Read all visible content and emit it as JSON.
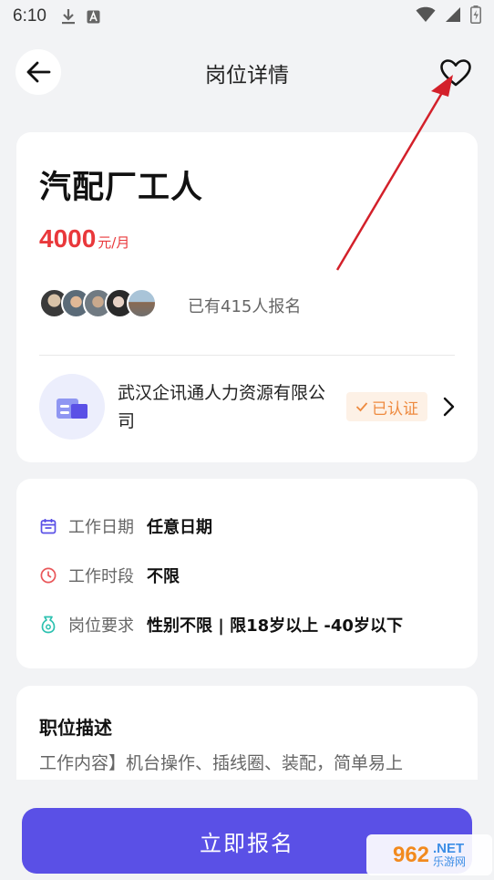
{
  "status_bar": {
    "time": "6:10"
  },
  "header": {
    "title": "岗位详情"
  },
  "job": {
    "title": "汽配厂工人",
    "salary_amount": "4000",
    "salary_unit": "元/月",
    "applied_text": "已有415人报名"
  },
  "company": {
    "name": "武汉企讯通人力资源有限公司",
    "verified_label": "已认证"
  },
  "info": {
    "rows": [
      {
        "label": "工作日期",
        "value": "任意日期",
        "icon": "calendar-icon"
      },
      {
        "label": "工作时段",
        "value": "不限",
        "icon": "clock-icon"
      },
      {
        "label": "岗位要求",
        "value": "性别不限 | 限18岁以上 -40岁以下",
        "icon": "requirement-icon"
      }
    ]
  },
  "description": {
    "title": "职位描述",
    "text": "工作内容】机台操作、插线圈、装配，简单易上"
  },
  "footer": {
    "apply_label": "立即报名"
  },
  "watermark": {
    "number": "962",
    "suffix": ".NET",
    "site": "乐游网"
  },
  "colors": {
    "accent": "#5a50e6",
    "salary": "#e9383b",
    "verified": "#ee8a3f",
    "annotation": "#d3202a"
  }
}
